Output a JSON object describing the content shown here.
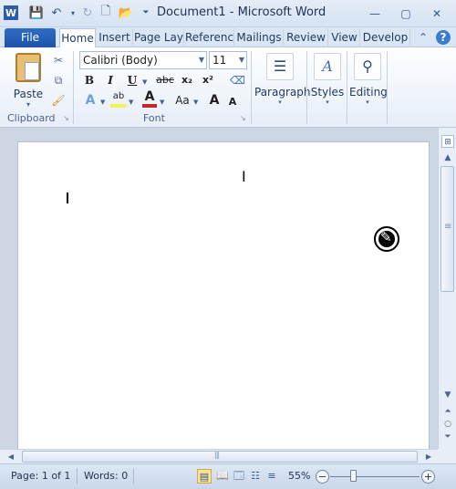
{
  "titlebar": {
    "title": "Document1  -  Microsoft Word",
    "quick_access": [
      "word-logo",
      "save",
      "undo",
      "redo",
      "new",
      "open",
      "customize"
    ]
  },
  "tabs": {
    "file": "File",
    "items": [
      "Home",
      "Insert",
      "Page Lay",
      "Referenc",
      "Mailings",
      "Review",
      "View",
      "Develop"
    ]
  },
  "ribbon": {
    "clipboard": {
      "paste_label": "Paste",
      "group_label": "Clipboard"
    },
    "font": {
      "font_name": "Calibri (Body)",
      "font_size": "11",
      "group_label": "Font",
      "bold": "B",
      "italic": "I",
      "underline": "U",
      "strike": "abc",
      "subscript": "x₂",
      "superscript": "x²",
      "grow": "A",
      "shrink": "A",
      "change_case": "Aa"
    },
    "paragraph_label": "Paragraph",
    "styles_label": "Styles",
    "editing_label": "Editing"
  },
  "status": {
    "page": "Page: 1 of 1",
    "words": "Words: 0",
    "zoom": "55%",
    "zoom_minus": "−",
    "zoom_plus": "+"
  }
}
